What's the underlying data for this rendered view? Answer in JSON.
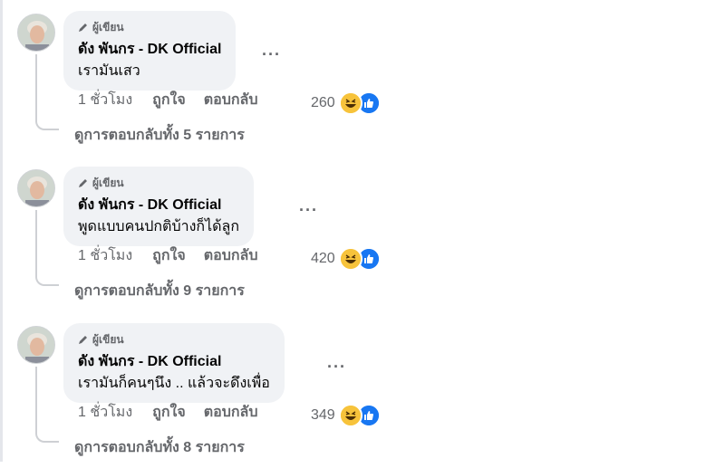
{
  "comments": [
    {
      "badge": "ผู้เขียน",
      "author": "ดัง พันกร - DK Official",
      "text": "เรามันเสว",
      "more_icon": "···",
      "time": "1 ชั่วโมง",
      "like_label": "ถูกใจ",
      "reply_label": "ตอบกลับ",
      "reaction_count": "260",
      "view_replies": "ดูการตอบกลับทั้ง 5 รายการ"
    },
    {
      "badge": "ผู้เขียน",
      "author": "ดัง พันกร - DK Official",
      "text": "พูดแบบคนปกติบ้างก็ได้ลูก",
      "more_icon": "···",
      "time": "1 ชั่วโมง",
      "like_label": "ถูกใจ",
      "reply_label": "ตอบกลับ",
      "reaction_count": "420",
      "view_replies": "ดูการตอบกลับทั้ง 9 รายการ"
    },
    {
      "badge": "ผู้เขียน",
      "author": "ดัง พันกร - DK Official",
      "text": "เรามันก็คนๆนึง .. แล้วจะดึงเพื่อ",
      "more_icon": "···",
      "time": "1 ชั่วโมง",
      "like_label": "ถูกใจ",
      "reply_label": "ตอบกลับ",
      "reaction_count": "349",
      "view_replies": "ดูการตอบกลับทั้ง 8 รายการ"
    }
  ],
  "icons": {
    "badge": "pencil-icon",
    "reaction_1": "haha-emoji-icon",
    "reaction_2": "like-thumb-icon",
    "more": "more-options-icon"
  },
  "colors": {
    "bubble": "#f0f2f5",
    "meta_text": "#65676b",
    "like_blue": "#1877f2",
    "haha_yellow": "#f7c33b"
  }
}
